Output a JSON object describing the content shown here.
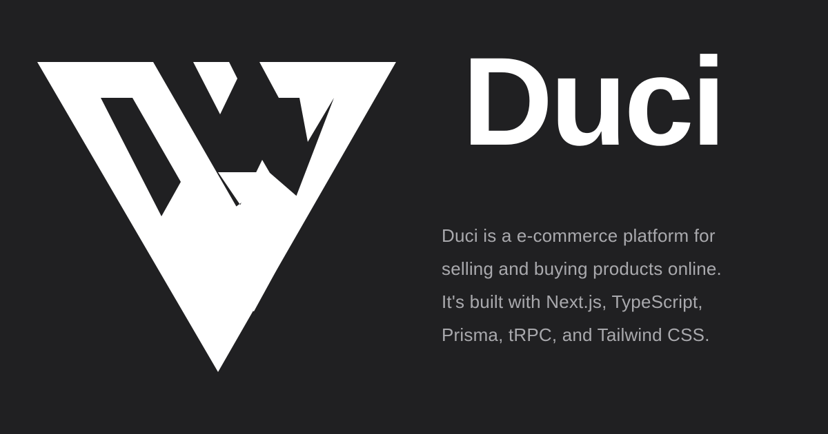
{
  "brand": {
    "name": "Duci",
    "logo_icon": "duci-triangle-logo-icon"
  },
  "description": {
    "lines": [
      "Duci is a e-commerce platform for",
      "selling and buying products online.",
      "It's built with Next.js, TypeScript,",
      "Prisma, tRPC, and Tailwind CSS."
    ]
  },
  "colors": {
    "background": "#202022",
    "title": "#ffffff",
    "logo": "#ffffff",
    "description": "#a9a9ad"
  }
}
